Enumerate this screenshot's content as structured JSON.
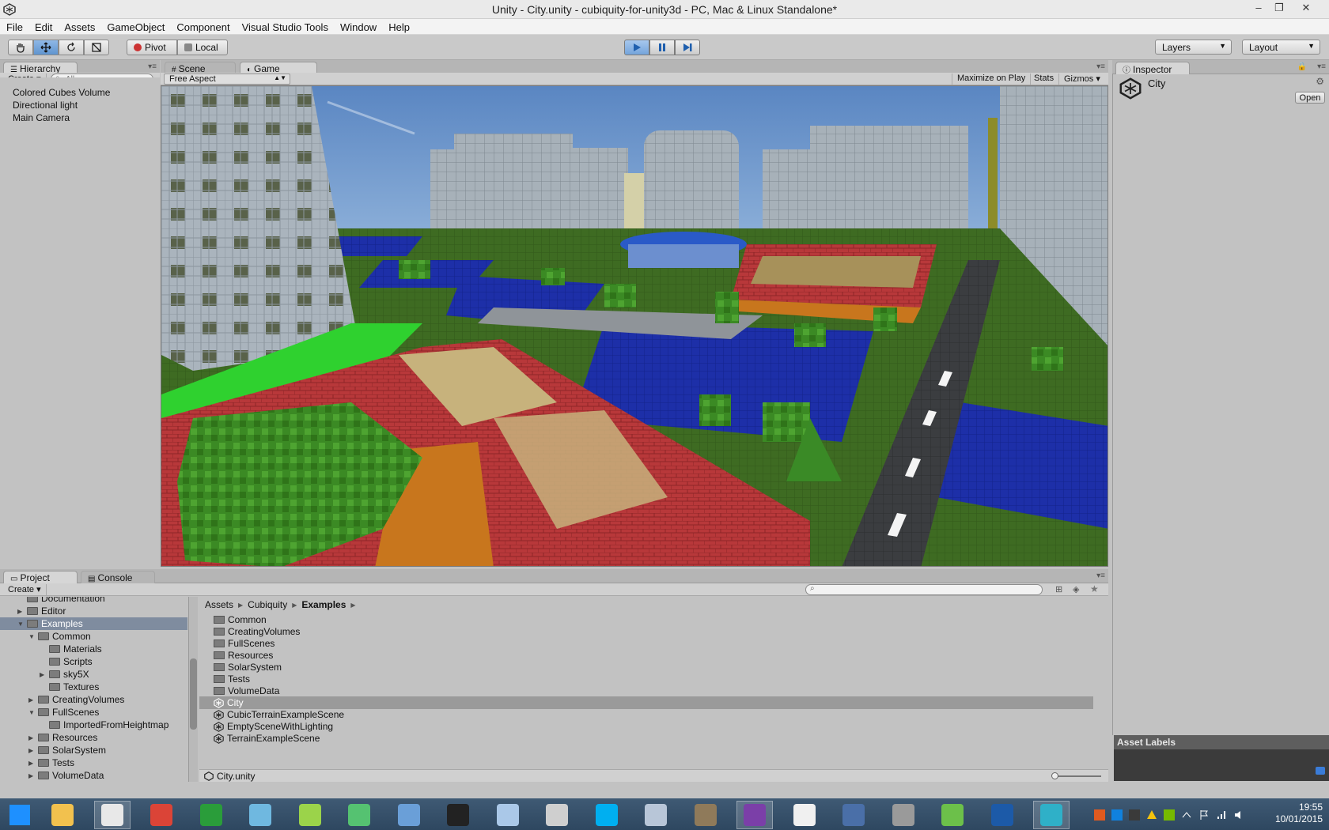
{
  "window": {
    "title": "Unity - City.unity - cubiquity-for-unity3d - PC, Mac & Linux Standalone*",
    "minimize": "–",
    "restore": "❐",
    "close": "✕"
  },
  "menu": [
    "File",
    "Edit",
    "Assets",
    "GameObject",
    "Component",
    "Visual Studio Tools",
    "Window",
    "Help"
  ],
  "toolbar": {
    "pivot_label": "Pivot",
    "local_label": "Local",
    "layers_label": "Layers",
    "layout_label": "Layout",
    "play_state": "playing"
  },
  "hierarchy": {
    "tab": "Hierarchy",
    "create": "Create",
    "search_placeholder": "All",
    "items": [
      "Colored Cubes Volume",
      "Directional light",
      "Main Camera"
    ]
  },
  "scene_tabs": {
    "scene": "Scene",
    "game": "Game",
    "aspect": "Free Aspect",
    "maximize": "Maximize on Play",
    "stats": "Stats",
    "gizmos": "Gizmos"
  },
  "inspector": {
    "tab": "Inspector",
    "object_name": "City",
    "open_button": "Open",
    "asset_labels": "Asset Labels"
  },
  "project": {
    "tab": "Project",
    "console_tab": "Console",
    "create": "Create",
    "tree": [
      {
        "label": "Documentation",
        "indent": 1,
        "arrow": "",
        "selected": false
      },
      {
        "label": "Editor",
        "indent": 1,
        "arrow": "▶",
        "selected": false
      },
      {
        "label": "Examples",
        "indent": 1,
        "arrow": "▼",
        "selected": true
      },
      {
        "label": "Common",
        "indent": 2,
        "arrow": "▼",
        "selected": false
      },
      {
        "label": "Materials",
        "indent": 3,
        "arrow": "",
        "selected": false
      },
      {
        "label": "Scripts",
        "indent": 3,
        "arrow": "",
        "selected": false
      },
      {
        "label": "sky5X",
        "indent": 3,
        "arrow": "▶",
        "selected": false
      },
      {
        "label": "Textures",
        "indent": 3,
        "arrow": "",
        "selected": false
      },
      {
        "label": "CreatingVolumes",
        "indent": 2,
        "arrow": "▶",
        "selected": false
      },
      {
        "label": "FullScenes",
        "indent": 2,
        "arrow": "▼",
        "selected": false
      },
      {
        "label": "ImportedFromHeightmap",
        "indent": 3,
        "arrow": "",
        "selected": false
      },
      {
        "label": "Resources",
        "indent": 2,
        "arrow": "▶",
        "selected": false
      },
      {
        "label": "SolarSystem",
        "indent": 2,
        "arrow": "▶",
        "selected": false
      },
      {
        "label": "Tests",
        "indent": 2,
        "arrow": "▶",
        "selected": false
      },
      {
        "label": "VolumeData",
        "indent": 2,
        "arrow": "▶",
        "selected": false
      }
    ],
    "breadcrumb": [
      "Assets",
      "Cubiquity",
      "Examples"
    ],
    "assets": [
      {
        "label": "Common",
        "type": "folder"
      },
      {
        "label": "CreatingVolumes",
        "type": "folder"
      },
      {
        "label": "FullScenes",
        "type": "folder"
      },
      {
        "label": "Resources",
        "type": "folder"
      },
      {
        "label": "SolarSystem",
        "type": "folder"
      },
      {
        "label": "Tests",
        "type": "folder"
      },
      {
        "label": "VolumeData",
        "type": "folder"
      },
      {
        "label": "City",
        "type": "scene",
        "selected": true
      },
      {
        "label": "CubicTerrainExampleScene",
        "type": "scene"
      },
      {
        "label": "EmptySceneWithLighting",
        "type": "scene"
      },
      {
        "label": "TerrainExampleScene",
        "type": "scene"
      }
    ],
    "footer_file": "City.unity"
  },
  "taskbar": {
    "time": "19:55",
    "date": "10/01/2015",
    "apps": [
      {
        "name": "start-icon",
        "color": "#1e90ff"
      },
      {
        "name": "file-explorer-icon",
        "color": "#f2c14e"
      },
      {
        "name": "unity-icon",
        "color": "#e8e8e8",
        "active": true
      },
      {
        "name": "chrome-icon",
        "color": "#db4437"
      },
      {
        "name": "triangle-app-icon",
        "color": "#2a9d3a"
      },
      {
        "name": "book-app-icon",
        "color": "#6fb8e0"
      },
      {
        "name": "notepad-plus-icon",
        "color": "#9bd34a"
      },
      {
        "name": "atom-icon",
        "color": "#55c271"
      },
      {
        "name": "qb-icon",
        "color": "#6a9fd8"
      },
      {
        "name": "terminal-icon",
        "color": "#222222"
      },
      {
        "name": "virtualbox-icon",
        "color": "#aac8e8"
      },
      {
        "name": "printer-icon",
        "color": "#cfcfcf"
      },
      {
        "name": "skype-icon",
        "color": "#00aff0"
      },
      {
        "name": "calculator-icon",
        "color": "#b8c6d8"
      },
      {
        "name": "gimp-icon",
        "color": "#8f7a5a"
      },
      {
        "name": "visual-studio-icon",
        "color": "#7b3fa8",
        "active": true
      },
      {
        "name": "text-editor-icon",
        "color": "#f0f0f0"
      },
      {
        "name": "keepass-icon",
        "color": "#4a6fa8"
      },
      {
        "name": "database-icon",
        "color": "#9a9a9a"
      },
      {
        "name": "evernote-icon",
        "color": "#6cc04a"
      },
      {
        "name": "qt-icon",
        "color": "#1c5aa8"
      },
      {
        "name": "snowflake-app-icon",
        "color": "#2fb0c8",
        "active": true
      }
    ]
  }
}
